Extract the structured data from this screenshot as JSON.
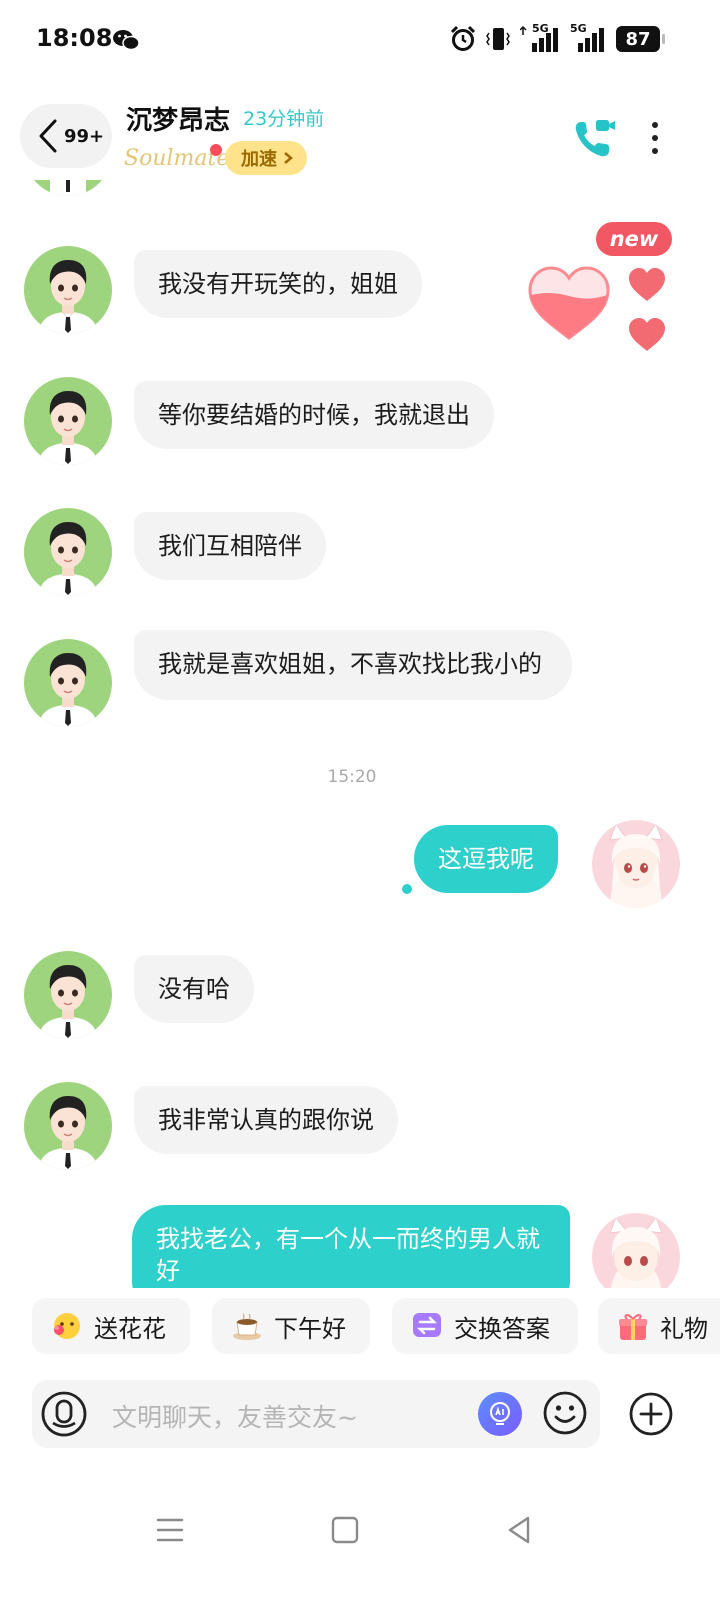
{
  "status_bar": {
    "time": "18:08",
    "network_1": "5G",
    "network_2": "5G",
    "battery": "87"
  },
  "header": {
    "back_count": "99+",
    "contact_name": "沉梦昂志",
    "last_seen": "23分钟前",
    "soulmate_logo": "Soulmate",
    "boost_label": "加速",
    "new_badge": "new"
  },
  "messages": [
    {
      "from": "them",
      "text": "我没有开玩笑的，姐姐"
    },
    {
      "from": "them",
      "text": "等你要结婚的时候，我就退出"
    },
    {
      "from": "them",
      "text": "我们互相陪伴"
    },
    {
      "from": "them",
      "text": "我就是喜欢姐姐，不喜欢找比我小的"
    },
    {
      "from": "timestamp",
      "text": "15:20"
    },
    {
      "from": "me",
      "text": "这逗我呢"
    },
    {
      "from": "them",
      "text": "没有哈"
    },
    {
      "from": "them",
      "text": "我非常认真的跟你说"
    },
    {
      "from": "me",
      "text": "我找老公，有一个从一而终的男人就好"
    }
  ],
  "quick_actions": [
    {
      "label": "送花花",
      "icon": "flower-face-icon"
    },
    {
      "label": "下午好",
      "icon": "coffee-icon"
    },
    {
      "label": "交换答案",
      "icon": "exchange-icon"
    },
    {
      "label": "礼物",
      "icon": "gift-icon"
    }
  ],
  "composer": {
    "placeholder": "文明聊天，友善交友~"
  },
  "colors": {
    "accent": "#2ed0cc",
    "incoming_bubble": "#f3f3f3",
    "boost_chip": "#ffe28a",
    "badge_red": "#f25863"
  }
}
